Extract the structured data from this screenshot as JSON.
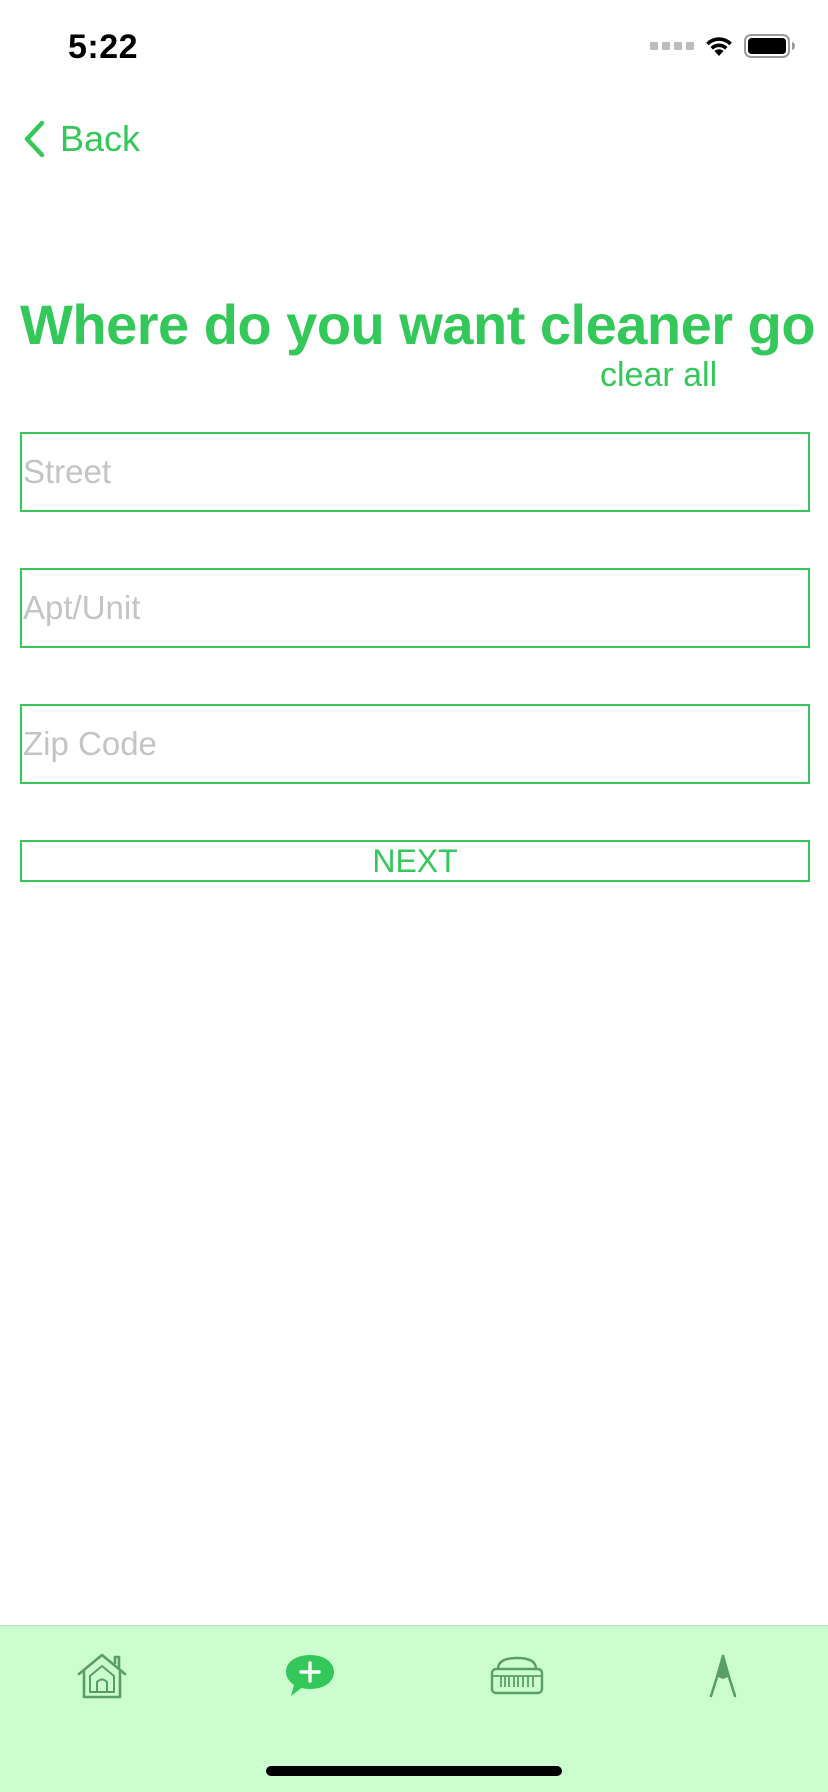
{
  "status_bar": {
    "time": "5:22"
  },
  "nav": {
    "back_label": "Back"
  },
  "page": {
    "title": "Where do you want cleaner go",
    "clear_all_label": "clear all"
  },
  "form": {
    "street": {
      "placeholder": "Street",
      "value": ""
    },
    "apt": {
      "placeholder": "Apt/Unit",
      "value": ""
    },
    "zip": {
      "placeholder": "Zip Code",
      "value": ""
    },
    "next_label": "NEXT"
  },
  "tab_bar": {
    "items": [
      {
        "icon": "home-icon",
        "active": false
      },
      {
        "icon": "add-chat-icon",
        "active": true
      },
      {
        "icon": "store-icon",
        "active": false
      },
      {
        "icon": "profile-icon",
        "active": false
      }
    ]
  },
  "colors": {
    "accent": "#34c759",
    "tab_bar_background": "#ccfdcf",
    "placeholder": "#c4c4c4",
    "inactive_icon": "#5a9e67"
  }
}
